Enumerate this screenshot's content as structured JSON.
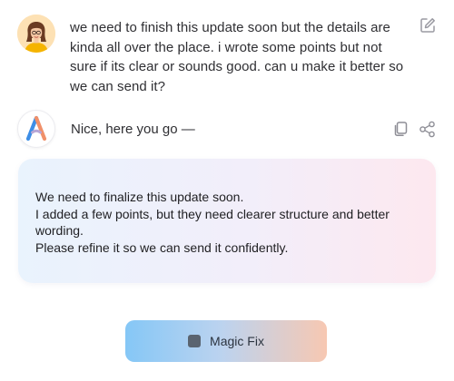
{
  "user_message": {
    "avatar_icon": "user-avatar",
    "text": "we need to finish this update soon but the details are kinda all over the place. i wrote some points but not sure if its clear or sounds good. can u make it better so we can send it?",
    "edit_icon": "edit-icon"
  },
  "assistant": {
    "logo_icon": "assistant-logo",
    "reply_intro": "Nice, here you go —",
    "copy_icon": "copy-icon",
    "share_icon": "share-icon",
    "card_lines": [
      "We need to finalize this update soon.",
      "I added a few points, but they need clearer structure and better wording.",
      "Please refine it so we can send it confidently."
    ]
  },
  "magic_button": {
    "label": "Magic Fix",
    "icon": "square-icon"
  },
  "colors": {
    "card_gradient_start": "#e9f3fd",
    "card_gradient_end": "#fde8ef",
    "button_gradient_start": "#85c7f6",
    "button_gradient_end": "#f7c8b2",
    "logo_blue": "#3d8ee6",
    "logo_orange": "#f0906a"
  }
}
